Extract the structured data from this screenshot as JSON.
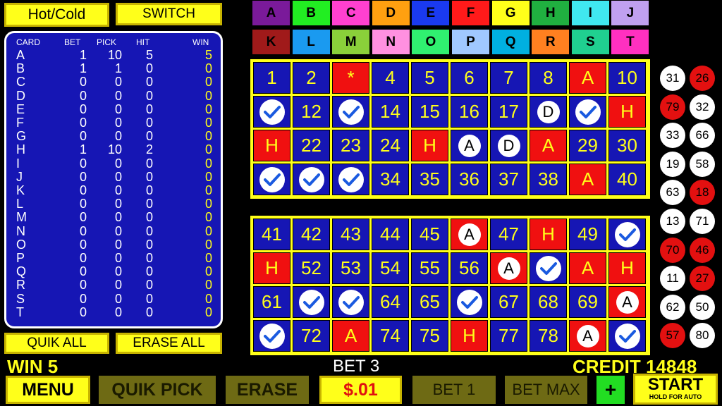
{
  "top_buttons": {
    "hot_cold": "Hot/Cold",
    "switch": "SWITCH"
  },
  "card_table": {
    "headers": {
      "card": "CARD",
      "bet": "BET",
      "pick": "PICK",
      "hit": "HIT",
      "win": "WIN"
    },
    "rows": [
      {
        "card": "A",
        "bet": "1",
        "pick": "10",
        "hit": "5",
        "win": "5"
      },
      {
        "card": "B",
        "bet": "1",
        "pick": "1",
        "hit": "0",
        "win": "0"
      },
      {
        "card": "C",
        "bet": "0",
        "pick": "0",
        "hit": "0",
        "win": "0"
      },
      {
        "card": "D",
        "bet": "0",
        "pick": "0",
        "hit": "0",
        "win": "0"
      },
      {
        "card": "E",
        "bet": "0",
        "pick": "0",
        "hit": "0",
        "win": "0"
      },
      {
        "card": "F",
        "bet": "0",
        "pick": "0",
        "hit": "0",
        "win": "0"
      },
      {
        "card": "G",
        "bet": "0",
        "pick": "0",
        "hit": "0",
        "win": "0"
      },
      {
        "card": "H",
        "bet": "1",
        "pick": "10",
        "hit": "2",
        "win": "0"
      },
      {
        "card": "I",
        "bet": "0",
        "pick": "0",
        "hit": "0",
        "win": "0"
      },
      {
        "card": "J",
        "bet": "0",
        "pick": "0",
        "hit": "0",
        "win": "0"
      },
      {
        "card": "K",
        "bet": "0",
        "pick": "0",
        "hit": "0",
        "win": "0"
      },
      {
        "card": "L",
        "bet": "0",
        "pick": "0",
        "hit": "0",
        "win": "0"
      },
      {
        "card": "M",
        "bet": "0",
        "pick": "0",
        "hit": "0",
        "win": "0"
      },
      {
        "card": "N",
        "bet": "0",
        "pick": "0",
        "hit": "0",
        "win": "0"
      },
      {
        "card": "O",
        "bet": "0",
        "pick": "0",
        "hit": "0",
        "win": "0"
      },
      {
        "card": "P",
        "bet": "0",
        "pick": "0",
        "hit": "0",
        "win": "0"
      },
      {
        "card": "Q",
        "bet": "0",
        "pick": "0",
        "hit": "0",
        "win": "0"
      },
      {
        "card": "R",
        "bet": "0",
        "pick": "0",
        "hit": "0",
        "win": "0"
      },
      {
        "card": "S",
        "bet": "0",
        "pick": "0",
        "hit": "0",
        "win": "0"
      },
      {
        "card": "T",
        "bet": "0",
        "pick": "0",
        "hit": "0",
        "win": "0"
      }
    ]
  },
  "side_buttons": {
    "quik_all": "QUIK ALL",
    "erase_all": "ERASE ALL"
  },
  "card_tabs": [
    {
      "label": "A",
      "color": "#7a1a9a"
    },
    {
      "label": "B",
      "color": "#22ee22"
    },
    {
      "label": "C",
      "color": "#ff40d0"
    },
    {
      "label": "D",
      "color": "#ffa010"
    },
    {
      "label": "E",
      "color": "#1a3af0"
    },
    {
      "label": "F",
      "color": "#ff1a1a"
    },
    {
      "label": "G",
      "color": "#ffff1a"
    },
    {
      "label": "H",
      "color": "#20b040"
    },
    {
      "label": "I",
      "color": "#40e8f0"
    },
    {
      "label": "J",
      "color": "#c0a0f0"
    },
    {
      "label": "K",
      "color": "#a01a1a"
    },
    {
      "label": "L",
      "color": "#1a9af0"
    },
    {
      "label": "M",
      "color": "#8ad03a"
    },
    {
      "label": "N",
      "color": "#ff90e0"
    },
    {
      "label": "O",
      "color": "#30f070"
    },
    {
      "label": "P",
      "color": "#a0c8ff"
    },
    {
      "label": "Q",
      "color": "#00b0e0"
    },
    {
      "label": "R",
      "color": "#ff8020"
    },
    {
      "label": "S",
      "color": "#20d090"
    },
    {
      "label": "T",
      "color": "#ff30c0"
    }
  ],
  "board_top": [
    {
      "t": "1",
      "bg": "blue"
    },
    {
      "t": "2",
      "bg": "blue"
    },
    {
      "t": "*",
      "bg": "red"
    },
    {
      "t": "4",
      "bg": "blue"
    },
    {
      "t": "5",
      "bg": "blue"
    },
    {
      "t": "6",
      "bg": "blue"
    },
    {
      "t": "7",
      "bg": "blue"
    },
    {
      "t": "8",
      "bg": "blue"
    },
    {
      "t": "A",
      "bg": "red"
    },
    {
      "t": "10",
      "bg": "blue"
    },
    {
      "t": "check",
      "bg": "blue"
    },
    {
      "t": "12",
      "bg": "blue"
    },
    {
      "t": "check",
      "bg": "blue"
    },
    {
      "t": "14",
      "bg": "blue"
    },
    {
      "t": "15",
      "bg": "blue"
    },
    {
      "t": "16",
      "bg": "blue"
    },
    {
      "t": "17",
      "bg": "blue"
    },
    {
      "t": "D",
      "bg": "blue",
      "circle": true
    },
    {
      "t": "check",
      "bg": "blue"
    },
    {
      "t": "H",
      "bg": "red"
    },
    {
      "t": "H",
      "bg": "red"
    },
    {
      "t": "22",
      "bg": "blue"
    },
    {
      "t": "23",
      "bg": "blue"
    },
    {
      "t": "24",
      "bg": "blue"
    },
    {
      "t": "H",
      "bg": "red"
    },
    {
      "t": "A",
      "bg": "blue",
      "circle": true
    },
    {
      "t": "D",
      "bg": "blue",
      "circle": true
    },
    {
      "t": "A",
      "bg": "red"
    },
    {
      "t": "29",
      "bg": "blue"
    },
    {
      "t": "30",
      "bg": "blue"
    },
    {
      "t": "check",
      "bg": "blue"
    },
    {
      "t": "check",
      "bg": "blue"
    },
    {
      "t": "check",
      "bg": "blue"
    },
    {
      "t": "34",
      "bg": "blue"
    },
    {
      "t": "35",
      "bg": "blue"
    },
    {
      "t": "36",
      "bg": "blue"
    },
    {
      "t": "37",
      "bg": "blue"
    },
    {
      "t": "38",
      "bg": "blue"
    },
    {
      "t": "A",
      "bg": "red"
    },
    {
      "t": "40",
      "bg": "blue"
    }
  ],
  "board_bottom": [
    {
      "t": "41",
      "bg": "blue"
    },
    {
      "t": "42",
      "bg": "blue"
    },
    {
      "t": "43",
      "bg": "blue"
    },
    {
      "t": "44",
      "bg": "blue"
    },
    {
      "t": "45",
      "bg": "blue"
    },
    {
      "t": "A",
      "bg": "red",
      "circle": true
    },
    {
      "t": "47",
      "bg": "blue"
    },
    {
      "t": "H",
      "bg": "red"
    },
    {
      "t": "49",
      "bg": "blue"
    },
    {
      "t": "check",
      "bg": "blue"
    },
    {
      "t": "H",
      "bg": "red"
    },
    {
      "t": "52",
      "bg": "blue"
    },
    {
      "t": "53",
      "bg": "blue"
    },
    {
      "t": "54",
      "bg": "blue"
    },
    {
      "t": "55",
      "bg": "blue"
    },
    {
      "t": "56",
      "bg": "blue"
    },
    {
      "t": "A",
      "bg": "red",
      "circle": true
    },
    {
      "t": "check",
      "bg": "blue"
    },
    {
      "t": "A",
      "bg": "red"
    },
    {
      "t": "H",
      "bg": "red"
    },
    {
      "t": "61",
      "bg": "blue"
    },
    {
      "t": "check",
      "bg": "blue"
    },
    {
      "t": "check",
      "bg": "blue"
    },
    {
      "t": "64",
      "bg": "blue"
    },
    {
      "t": "65",
      "bg": "blue"
    },
    {
      "t": "check",
      "bg": "blue"
    },
    {
      "t": "67",
      "bg": "blue"
    },
    {
      "t": "68",
      "bg": "blue"
    },
    {
      "t": "69",
      "bg": "blue"
    },
    {
      "t": "A",
      "bg": "red",
      "circle": true
    },
    {
      "t": "check",
      "bg": "blue"
    },
    {
      "t": "72",
      "bg": "blue"
    },
    {
      "t": "A",
      "bg": "red"
    },
    {
      "t": "74",
      "bg": "blue"
    },
    {
      "t": "75",
      "bg": "blue"
    },
    {
      "t": "H",
      "bg": "red"
    },
    {
      "t": "77",
      "bg": "blue"
    },
    {
      "t": "78",
      "bg": "blue"
    },
    {
      "t": "A",
      "bg": "red",
      "circle": true
    },
    {
      "t": "check",
      "bg": "blue"
    }
  ],
  "drawn_balls": [
    {
      "n": "31",
      "c": "white"
    },
    {
      "n": "26",
      "c": "red"
    },
    {
      "n": "79",
      "c": "red"
    },
    {
      "n": "32",
      "c": "white"
    },
    {
      "n": "33",
      "c": "white"
    },
    {
      "n": "66",
      "c": "white"
    },
    {
      "n": "19",
      "c": "white"
    },
    {
      "n": "58",
      "c": "white"
    },
    {
      "n": "63",
      "c": "white"
    },
    {
      "n": "18",
      "c": "red"
    },
    {
      "n": "13",
      "c": "white"
    },
    {
      "n": "71",
      "c": "white"
    },
    {
      "n": "70",
      "c": "red"
    },
    {
      "n": "46",
      "c": "red"
    },
    {
      "n": "11",
      "c": "white"
    },
    {
      "n": "27",
      "c": "red"
    },
    {
      "n": "62",
      "c": "white"
    },
    {
      "n": "50",
      "c": "white"
    },
    {
      "n": "57",
      "c": "red"
    },
    {
      "n": "80",
      "c": "white"
    }
  ],
  "status": {
    "win": "WIN 5",
    "bet": "BET 3",
    "credit": "CREDIT 14848"
  },
  "bottom_bar": {
    "menu": "MENU",
    "quik_pick": "QUIK PICK",
    "erase": "ERASE",
    "denom": "$.01",
    "bet_one": "BET 1",
    "bet_max": "BET MAX",
    "plus": "+",
    "start": "START",
    "start_sub": "HOLD FOR AUTO"
  }
}
